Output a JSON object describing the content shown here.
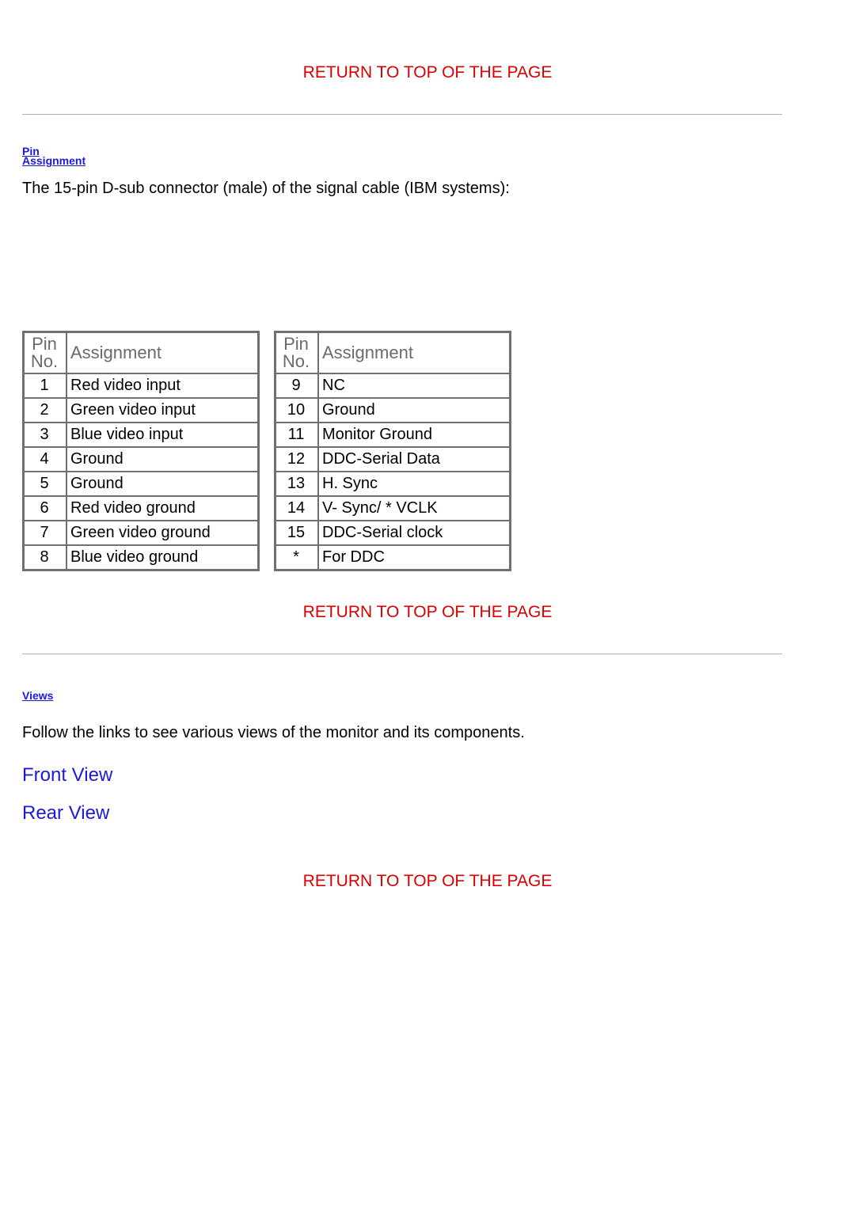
{
  "links": {
    "return_top": "RETURN TO TOP OF THE PAGE",
    "front_view": "Front View",
    "rear_view": "Rear View"
  },
  "anchors": {
    "pin": "Pin Assignment",
    "views": "Views"
  },
  "intro": {
    "pin_text": "The 15-pin D-sub connector (male) of the signal cable (IBM systems):",
    "views_text": "Follow the links to see various views of the monitor and its components."
  },
  "table_headers": {
    "pin_no": "Pin\nNo.",
    "assignment": "Assignment"
  },
  "pins_left": [
    {
      "no": "1",
      "assign": "Red video input"
    },
    {
      "no": "2",
      "assign": "Green video input"
    },
    {
      "no": "3",
      "assign": "Blue video input"
    },
    {
      "no": "4",
      "assign": "Ground"
    },
    {
      "no": "5",
      "assign": "Ground"
    },
    {
      "no": "6",
      "assign": "Red video ground"
    },
    {
      "no": "7",
      "assign": "Green video ground"
    },
    {
      "no": "8",
      "assign": "Blue video ground"
    }
  ],
  "pins_right": [
    {
      "no": "9",
      "assign": "NC"
    },
    {
      "no": "10",
      "assign": "Ground"
    },
    {
      "no": "11",
      "assign": "Monitor Ground"
    },
    {
      "no": "12",
      "assign": "DDC-Serial Data"
    },
    {
      "no": "13",
      "assign": "H. Sync"
    },
    {
      "no": "14",
      "assign": "V- Sync/ * VCLK"
    },
    {
      "no": "15",
      "assign": "DDC-Serial clock"
    },
    {
      "no": "*",
      "assign": "For DDC"
    }
  ]
}
